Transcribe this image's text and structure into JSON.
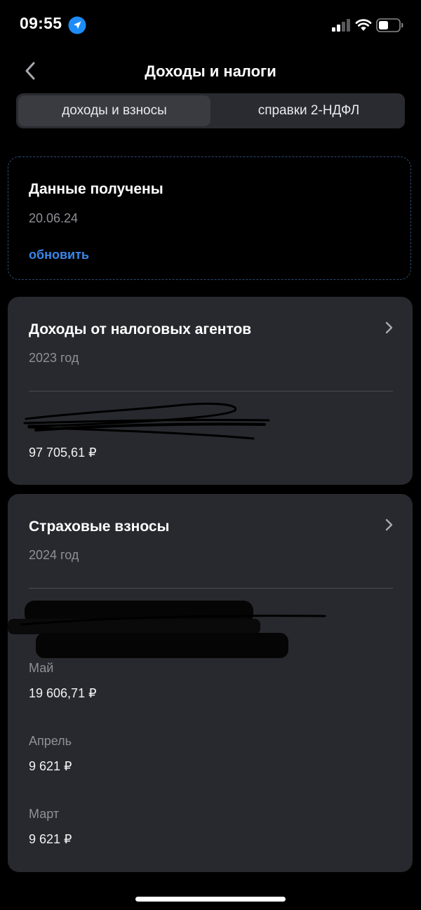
{
  "status": {
    "time": "09:55",
    "icons": [
      "location-arrow-icon",
      "cellular-signal-icon",
      "wifi-icon",
      "battery-icon"
    ]
  },
  "nav": {
    "title": "Доходы и налоги",
    "back_icon": "chevron-left-icon"
  },
  "tabs": [
    {
      "label": "доходы и взносы",
      "active": true
    },
    {
      "label": "справки 2-НДФЛ",
      "active": false
    }
  ],
  "info_card": {
    "title": "Данные получены",
    "date": "20.06.24",
    "refresh_label": "обновить"
  },
  "cards": [
    {
      "title": "Доходы от налоговых агентов",
      "subtitle": "2023 год",
      "amount": "97 705,61 ₽"
    },
    {
      "title": "Страховые взносы",
      "subtitle": "2024 год",
      "months": [
        {
          "label": "Май",
          "amount": "19 606,71 ₽"
        },
        {
          "label": "Апрель",
          "amount": "9 621 ₽"
        },
        {
          "label": "Март",
          "amount": "9 621 ₽"
        }
      ]
    }
  ],
  "colors": {
    "background": "#000000",
    "card": "#28292e",
    "accent": "#3a87e8",
    "muted_text": "#8f9098",
    "segment_active": "#3a3b41"
  }
}
